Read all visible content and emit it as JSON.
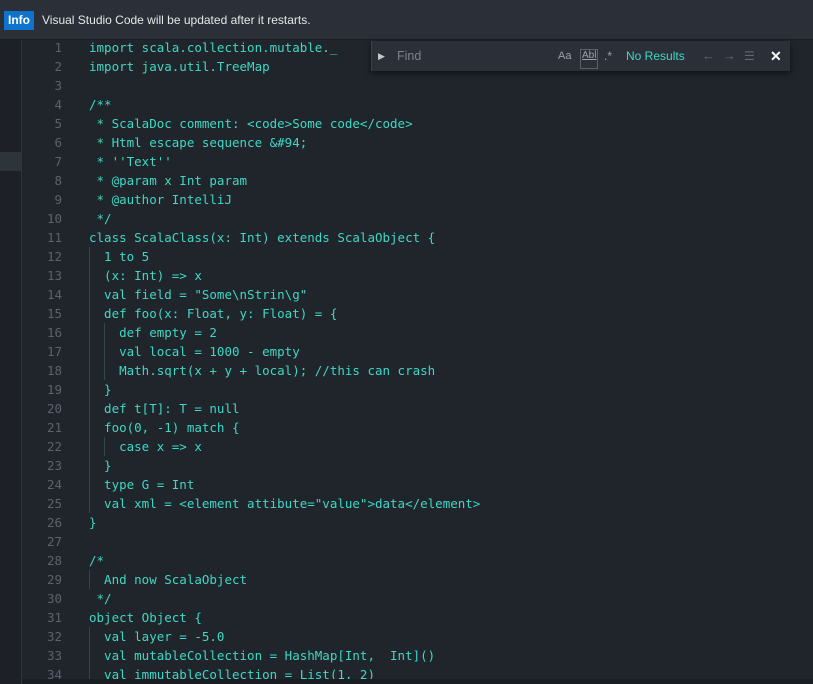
{
  "notification": {
    "badge": "Info",
    "message": "Visual Studio Code will be updated after it restarts."
  },
  "find": {
    "toggle_icon": "chevron-right-icon",
    "placeholder": "Find",
    "match_case_label": "Aa",
    "whole_word_label": "Abl",
    "regex_icon": "regex-icon",
    "results": "No Results",
    "prev_icon": "arrow-left-icon",
    "next_icon": "arrow-right-icon",
    "selection_icon": "find-in-selection-icon",
    "close_icon": "close-icon"
  },
  "colors": {
    "code_text": "#3fd7c5",
    "line_numbers": "#59626d",
    "editor_bg": "#20252b",
    "info_badge": "#0e73cc"
  },
  "lines": [
    {
      "n": "1",
      "text": "import scala.collection.mutable._"
    },
    {
      "n": "2",
      "text": "import java.util.TreeMap"
    },
    {
      "n": "3",
      "text": ""
    },
    {
      "n": "4",
      "text": "/**"
    },
    {
      "n": "5",
      "text": " * ScalaDoc comment: <code>Some code</code>"
    },
    {
      "n": "6",
      "text": " * Html escape sequence &#94;"
    },
    {
      "n": "7",
      "text": " * ''Text''"
    },
    {
      "n": "8",
      "text": " * @param x Int param"
    },
    {
      "n": "9",
      "text": " * @author IntelliJ"
    },
    {
      "n": "10",
      "text": " */"
    },
    {
      "n": "11",
      "text": "class ScalaClass(x: Int) extends ScalaObject {"
    },
    {
      "n": "12",
      "text": "  1 to 5"
    },
    {
      "n": "13",
      "text": "  (x: Int) => x"
    },
    {
      "n": "14",
      "text": "  val field = \"Some\\nStrin\\g\""
    },
    {
      "n": "15",
      "text": "  def foo(x: Float, y: Float) = {"
    },
    {
      "n": "16",
      "text": "    def empty = 2"
    },
    {
      "n": "17",
      "text": "    val local = 1000 - empty"
    },
    {
      "n": "18",
      "text": "    Math.sqrt(x + y + local); //this can crash"
    },
    {
      "n": "19",
      "text": "  }"
    },
    {
      "n": "20",
      "text": "  def t[T]: T = null"
    },
    {
      "n": "21",
      "text": "  foo(0, -1) match {"
    },
    {
      "n": "22",
      "text": "    case x => x"
    },
    {
      "n": "23",
      "text": "  }"
    },
    {
      "n": "24",
      "text": "  type G = Int"
    },
    {
      "n": "25",
      "text": "  val xml = <element attibute=\"value\">data</element>"
    },
    {
      "n": "26",
      "text": "}"
    },
    {
      "n": "27",
      "text": ""
    },
    {
      "n": "28",
      "text": "/*"
    },
    {
      "n": "29",
      "text": "  And now ScalaObject"
    },
    {
      "n": "30",
      "text": " */"
    },
    {
      "n": "31",
      "text": "object Object {"
    },
    {
      "n": "32",
      "text": "  val layer = -5.0"
    },
    {
      "n": "33",
      "text": "  val mutableCollection = HashMap[Int,  Int]()"
    },
    {
      "n": "34",
      "text": "  val immutableCollection = List(1, 2)"
    }
  ]
}
